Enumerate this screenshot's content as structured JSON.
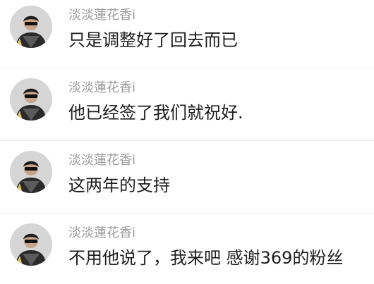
{
  "comments": [
    {
      "username": "淡淡蓮花香i",
      "text": "只是调整好了回去而已",
      "avatar_icon": "user-avatar-icon"
    },
    {
      "username": "淡淡蓮花香i",
      "text": "他已经签了我们就祝好.",
      "avatar_icon": "user-avatar-icon"
    },
    {
      "username": "淡淡蓮花香i",
      "text": "这两年的支持",
      "avatar_icon": "user-avatar-icon"
    },
    {
      "username": "淡淡蓮花香i",
      "text": "不用他说了，我来吧 感谢369的粉丝",
      "avatar_icon": "user-avatar-icon"
    }
  ],
  "colors": {
    "background": "#ffffff",
    "username": "#9b9b9b",
    "content": "#1e1e1e",
    "divider": "#ececec"
  }
}
